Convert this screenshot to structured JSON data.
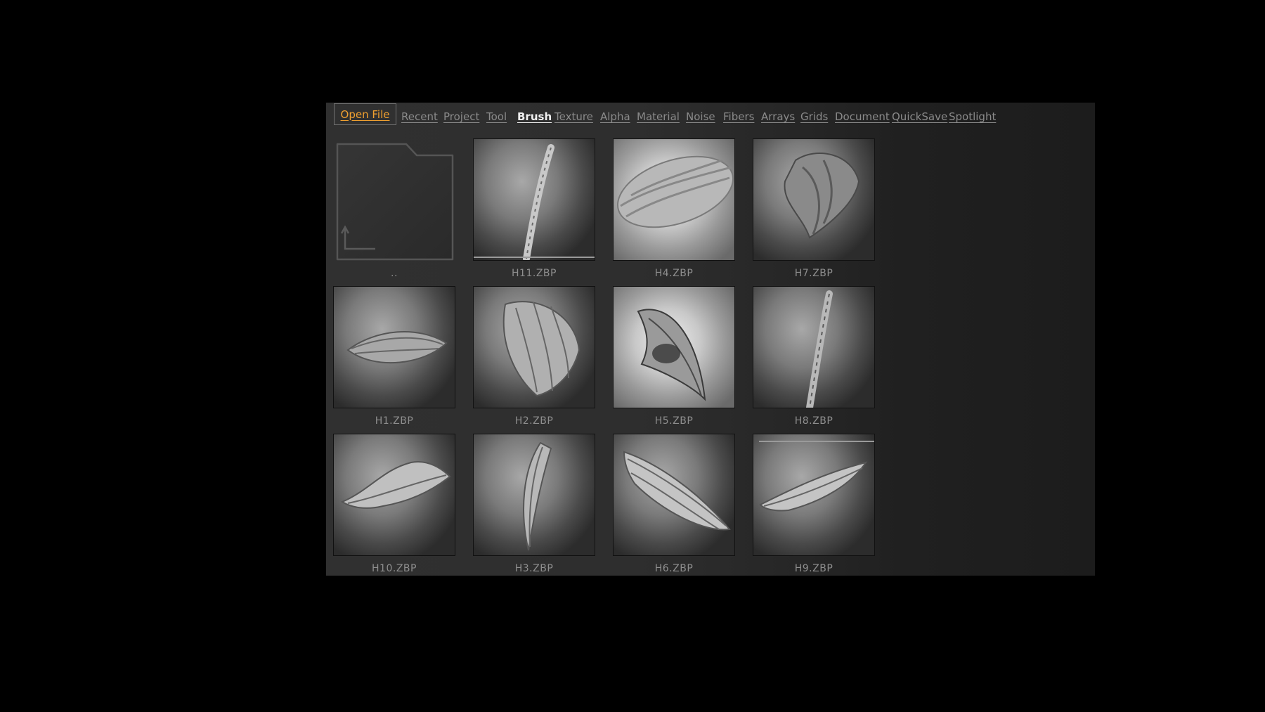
{
  "toolbar": {
    "open_file_label": "Open File",
    "tabs": [
      {
        "label": "Recent"
      },
      {
        "label": "Project"
      },
      {
        "label": "Tool"
      },
      {
        "label": "Brush",
        "active": true
      },
      {
        "label": "Texture"
      },
      {
        "label": "Alpha"
      },
      {
        "label": "Material"
      },
      {
        "label": "Noise"
      },
      {
        "label": "Fibers"
      },
      {
        "label": "Arrays"
      },
      {
        "label": "Grids"
      },
      {
        "label": "Document"
      },
      {
        "label": "QuickSave"
      },
      {
        "label": "Spotlight"
      }
    ]
  },
  "files": [
    {
      "name": "..",
      "icon": "parent-folder-icon"
    },
    {
      "name": "H11.ZBP",
      "icon": "hair-brush-preview"
    },
    {
      "name": "H4.ZBP",
      "icon": "hair-brush-preview"
    },
    {
      "name": "H7.ZBP",
      "icon": "hair-brush-preview"
    },
    {
      "name": "H1.ZBP",
      "icon": "hair-brush-preview"
    },
    {
      "name": "H2.ZBP",
      "icon": "hair-brush-preview"
    },
    {
      "name": "H5.ZBP",
      "icon": "hair-brush-preview"
    },
    {
      "name": "H8.ZBP",
      "icon": "hair-brush-preview"
    },
    {
      "name": "H10.ZBP",
      "icon": "hair-brush-preview"
    },
    {
      "name": "H3.ZBP",
      "icon": "hair-brush-preview"
    },
    {
      "name": "H6.ZBP",
      "icon": "hair-brush-preview"
    },
    {
      "name": "H9.ZBP",
      "icon": "hair-brush-preview"
    }
  ],
  "colors": {
    "background": "#000000",
    "panel": "#2e2e2e",
    "accent": "#f0a030",
    "tab_text": "#8a8a8a",
    "tab_active_text": "#f0f0f0"
  }
}
